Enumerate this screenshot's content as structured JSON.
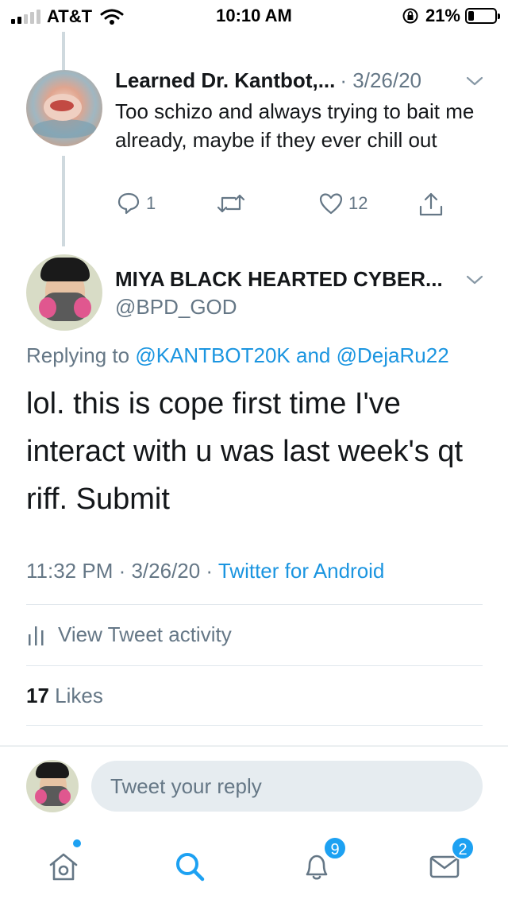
{
  "status_bar": {
    "carrier": "AT&T",
    "time": "10:10 AM",
    "battery": "21%"
  },
  "reply_tweet": {
    "author": "Learned Dr. Kantbot,...",
    "date": "· 3/26/20",
    "text": "Too schizo and always trying to bait me already, maybe if they ever chill out",
    "reply_count": "1",
    "like_count": "12"
  },
  "main_tweet": {
    "author": "MIYA BLACK HEARTED CYBER...",
    "handle": "@BPD_GOD",
    "replying_prefix": "Replying to",
    "replying_user1": "@KANTBOT20K",
    "replying_and": "and",
    "replying_user2": "@DejaRu22",
    "text": "lol. this is cope first time I've interact with u was last week's qt riff. Submit",
    "timestamp": "11:32 PM · 3/26/20 ·",
    "source": "Twitter for Android",
    "activity_label": "View Tweet activity",
    "likes_count": "17",
    "likes_label": "Likes"
  },
  "composer": {
    "placeholder": "Tweet your reply"
  },
  "tab_bar": {
    "notifications_badge": "9",
    "messages_badge": "2"
  },
  "colors": {
    "accent": "#1da1f2",
    "link": "#1b95e0",
    "secondary_text": "#657786"
  }
}
